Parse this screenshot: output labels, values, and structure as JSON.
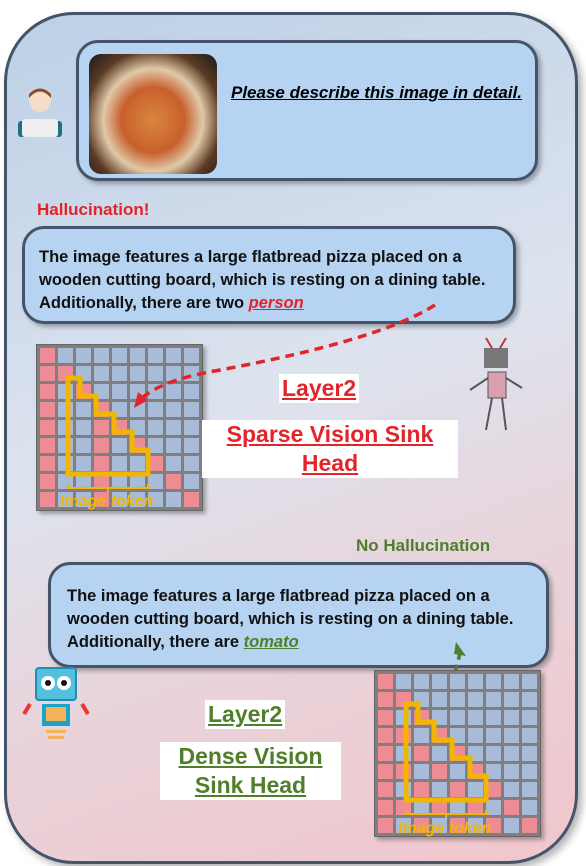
{
  "user_prompt": {
    "text": "Please describe this image in detail.",
    "image": "pizza-photo"
  },
  "sparse": {
    "status": "Hallucination!",
    "response_prefix": "The image features a large flatbread pizza placed on a wooden cutting board, which is resting on a dining table. Additionally, there are two ",
    "highlight": "person",
    "layer": "Layer2",
    "head": "Sparse Vision Sink Head",
    "token_label": "Image token",
    "color": "#e3242b"
  },
  "dense": {
    "status": "No Hallucination",
    "response_prefix": "The image features a large flatbread pizza placed on a wooden cutting board, which is resting on a dining table. Additionally, there are ",
    "highlight": "tomato",
    "layer": "Layer2",
    "head": "Dense Vision Sink Head",
    "token_label": "Image token",
    "color": "#4f7f2a"
  },
  "colors": {
    "bubble": "#b6d4f2",
    "border": "#44546a",
    "token": "#f2b600",
    "attention": "#ee8c96"
  },
  "icons": [
    "user-with-headset-icon",
    "bad-robot-icon",
    "good-robot-icon"
  ]
}
